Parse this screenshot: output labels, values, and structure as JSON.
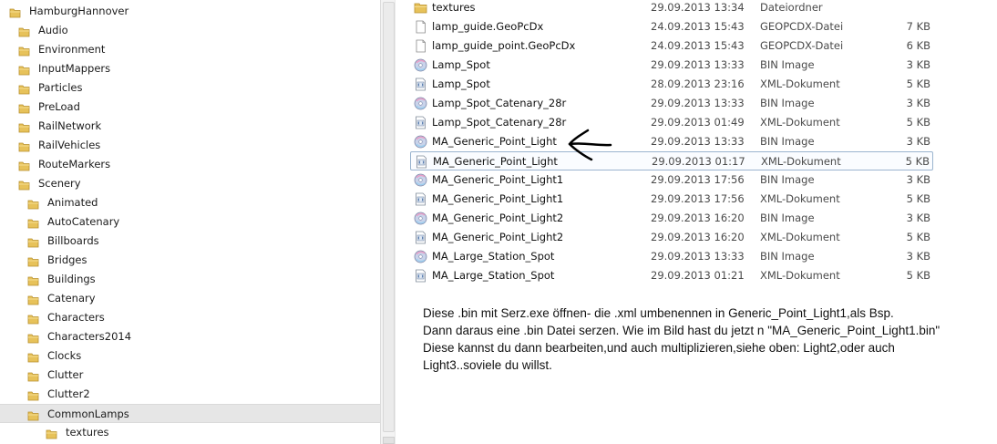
{
  "nav": {
    "items": [
      {
        "label": "HamburgHannover",
        "level": 0
      },
      {
        "label": "Audio",
        "level": 1
      },
      {
        "label": "Environment",
        "level": 1
      },
      {
        "label": "InputMappers",
        "level": 1
      },
      {
        "label": "Particles",
        "level": 1
      },
      {
        "label": "PreLoad",
        "level": 1
      },
      {
        "label": "RailNetwork",
        "level": 1
      },
      {
        "label": "RailVehicles",
        "level": 1
      },
      {
        "label": "RouteMarkers",
        "level": 1
      },
      {
        "label": "Scenery",
        "level": 1
      },
      {
        "label": "Animated",
        "level": 2
      },
      {
        "label": "AutoCatenary",
        "level": 2
      },
      {
        "label": "Billboards",
        "level": 2
      },
      {
        "label": "Bridges",
        "level": 2
      },
      {
        "label": "Buildings",
        "level": 2
      },
      {
        "label": "Catenary",
        "level": 2
      },
      {
        "label": "Characters",
        "level": 2
      },
      {
        "label": "Characters2014",
        "level": 2
      },
      {
        "label": "Clocks",
        "level": 2
      },
      {
        "label": "Clutter",
        "level": 2
      },
      {
        "label": "Clutter2",
        "level": 2
      },
      {
        "label": "CommonLamps",
        "level": 2,
        "selected": true
      },
      {
        "label": "textures",
        "level": 3
      }
    ]
  },
  "files": [
    {
      "name": "textures",
      "date": "29.09.2013 13:34",
      "type": "Dateiordner",
      "size": "",
      "icon": "folder-icon"
    },
    {
      "name": "lamp_guide.GeoPcDx",
      "date": "24.09.2013 15:43",
      "type": "GEOPCDX-Datei",
      "size": "7 KB",
      "icon": "document-icon"
    },
    {
      "name": "lamp_guide_point.GeoPcDx",
      "date": "24.09.2013 15:43",
      "type": "GEOPCDX-Datei",
      "size": "6 KB",
      "icon": "document-icon"
    },
    {
      "name": "Lamp_Spot",
      "date": "29.09.2013 13:33",
      "type": "BIN Image",
      "size": "3 KB",
      "icon": "disc-image-icon"
    },
    {
      "name": "Lamp_Spot",
      "date": "28.09.2013 23:16",
      "type": "XML-Dokument",
      "size": "5 KB",
      "icon": "xml-icon"
    },
    {
      "name": "Lamp_Spot_Catenary_28r",
      "date": "29.09.2013 13:33",
      "type": "BIN Image",
      "size": "3 KB",
      "icon": "disc-image-icon"
    },
    {
      "name": "Lamp_Spot_Catenary_28r",
      "date": "29.09.2013 01:49",
      "type": "XML-Dokument",
      "size": "5 KB",
      "icon": "xml-icon"
    },
    {
      "name": "MA_Generic_Point_Light",
      "date": "29.09.2013 13:33",
      "type": "BIN Image",
      "size": "3 KB",
      "icon": "disc-image-icon"
    },
    {
      "name": "MA_Generic_Point_Light",
      "date": "29.09.2013 01:17",
      "type": "XML-Dokument",
      "size": "5 KB",
      "icon": "xml-icon",
      "focused": true
    },
    {
      "name": "MA_Generic_Point_Light1",
      "date": "29.09.2013 17:56",
      "type": "BIN Image",
      "size": "3 KB",
      "icon": "disc-image-icon"
    },
    {
      "name": "MA_Generic_Point_Light1",
      "date": "29.09.2013 17:56",
      "type": "XML-Dokument",
      "size": "5 KB",
      "icon": "xml-icon"
    },
    {
      "name": "MA_Generic_Point_Light2",
      "date": "29.09.2013 16:20",
      "type": "BIN Image",
      "size": "3 KB",
      "icon": "disc-image-icon"
    },
    {
      "name": "MA_Generic_Point_Light2",
      "date": "29.09.2013 16:20",
      "type": "XML-Dokument",
      "size": "5 KB",
      "icon": "xml-icon"
    },
    {
      "name": "MA_Large_Station_Spot",
      "date": "29.09.2013 13:33",
      "type": "BIN Image",
      "size": "3 KB",
      "icon": "disc-image-icon"
    },
    {
      "name": "MA_Large_Station_Spot",
      "date": "29.09.2013 01:21",
      "type": "XML-Dokument",
      "size": "5 KB",
      "icon": "xml-icon"
    }
  ],
  "annotation": {
    "lines": [
      "Diese .bin mit Serz.exe öffnen- die .xml umbenennen in Generic_Point_Light1,als Bsp.",
      "Dann daraus eine .bin Datei serzen. Wie im Bild hast du jetzt n \"MA_Generic_Point_Light1.bin\"",
      "Diese kannst du dann bearbeiten,und auch multiplizieren,siehe oben: Light2,oder auch",
      "Light3..soviele du willst."
    ]
  },
  "colors": {
    "folder": "#e7c25a",
    "selection": "#e6e6e6",
    "focus_border": "#9bb4cf"
  }
}
